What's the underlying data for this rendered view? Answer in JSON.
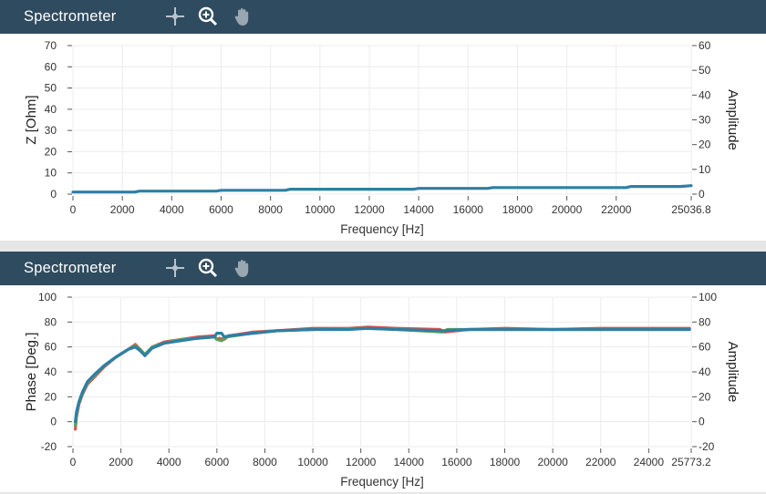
{
  "panels": [
    {
      "title": "Spectrometer",
      "tools": {
        "crosshair": "crosshair-icon",
        "zoom": "zoom-in-icon",
        "pan": "hand-pan-icon"
      },
      "chart_data": {
        "type": "line",
        "xlabel": "Frequency [Hz]",
        "ylabel": "Z [Ohm]",
        "y2label": "Amplitude",
        "xlim": [
          0,
          25036.8
        ],
        "ylim": [
          0,
          70
        ],
        "y2lim": [
          0,
          60
        ],
        "xticks": [
          "0",
          "2000",
          "4000",
          "6000",
          "8000",
          "10000",
          "12000",
          "14000",
          "16000",
          "18000",
          "20000",
          "22000",
          "25036.8"
        ],
        "yticks": [
          "0",
          "10",
          "20",
          "30",
          "40",
          "50",
          "60",
          "70"
        ],
        "y2ticks": [
          "0",
          "10",
          "20",
          "30",
          "40",
          "50",
          "60"
        ],
        "grid": true,
        "series": [
          {
            "color": "#2e7fa6",
            "x": [
              0,
              2500,
              2700,
              5800,
              6000,
              8600,
              8800,
              13800,
              14000,
              16800,
              17000,
              22400,
              22600,
              24600,
              25036.8
            ],
            "y": [
              1.0,
              1.0,
              1.4,
              1.4,
              1.8,
              1.8,
              2.3,
              2.3,
              2.7,
              2.7,
              3.1,
              3.1,
              3.6,
              3.6,
              4.0
            ]
          }
        ]
      }
    },
    {
      "title": "Spectrometer",
      "tools": {
        "crosshair": "crosshair-icon",
        "zoom": "zoom-in-icon",
        "pan": "hand-pan-icon"
      },
      "chart_data": {
        "type": "line",
        "xlabel": "Frequency [Hz]",
        "ylabel": "Phase [Deg.]",
        "y2label": "Amplitude",
        "xlim": [
          0,
          25773.2
        ],
        "ylim": [
          -20,
          100
        ],
        "y2lim": [
          -20,
          100
        ],
        "xticks": [
          "0",
          "2000",
          "4000",
          "6000",
          "8000",
          "10000",
          "12000",
          "14000",
          "16000",
          "18000",
          "20000",
          "22000",
          "24000",
          "25773.2"
        ],
        "yticks": [
          "-20",
          "0",
          "20",
          "40",
          "60",
          "80",
          "100"
        ],
        "y2ticks": [
          "-20",
          "0",
          "20",
          "40",
          "60",
          "80",
          "100"
        ],
        "grid": true,
        "series": [
          {
            "color": "#d9534f",
            "x": [
              100,
              150,
              250,
              400,
              600,
              900,
              1300,
              1800,
              2300,
              2600,
              2800,
              3000,
              3300,
              3800,
              4500,
              5200,
              5900,
              6000,
              6100,
              6300,
              6500,
              7500,
              8500,
              10000,
              11500,
              12300,
              13500,
              15300,
              15500,
              16500,
              18000,
              20000,
              22000,
              24000,
              25700
            ],
            "y": [
              -6,
              4,
              14,
              22,
              30,
              36,
              44,
              52,
              58,
              62,
              58,
              53,
              60,
              64,
              66,
              68,
              69,
              66,
              67,
              66,
              69,
              72,
              73,
              75,
              75,
              76,
              75,
              74,
              72,
              74,
              75,
              74,
              75,
              75,
              75
            ]
          },
          {
            "color": "#5aa05a",
            "x": [
              100,
              150,
              250,
              400,
              600,
              900,
              1300,
              1800,
              2300,
              2600,
              2800,
              3000,
              3300,
              3800,
              4500,
              5200,
              5900,
              6000,
              6200,
              6400,
              7500,
              8500,
              10000,
              12000,
              13500,
              15400,
              15600,
              16500,
              18000,
              20000,
              22000,
              24000,
              25700
            ],
            "y": [
              -3,
              6,
              15,
              23,
              31,
              37,
              45,
              52,
              58,
              61,
              58,
              54,
              60,
              63,
              66,
              67,
              68,
              66,
              65,
              68,
              71,
              73,
              74,
              75,
              74,
              72,
              74,
              74,
              74,
              74,
              74,
              74,
              74
            ]
          },
          {
            "color": "#2e7fa6",
            "x": [
              100,
              150,
              250,
              400,
              600,
              900,
              1300,
              1800,
              2300,
              2600,
              2800,
              3000,
              3300,
              3800,
              4500,
              5200,
              5900,
              6000,
              6100,
              6200,
              6300,
              6500,
              7500,
              8500,
              10000,
              11500,
              12300,
              13500,
              15500,
              16500,
              18000,
              20000,
              22000,
              24000,
              25700
            ],
            "y": [
              0,
              8,
              16,
              24,
              32,
              38,
              45,
              52,
              58,
              60,
              57,
              53,
              59,
              63,
              65,
              67,
              68,
              71,
              71,
              71,
              68,
              69,
              71,
              73,
              74,
              74,
              75,
              74,
              73,
              74,
              74,
              74,
              74,
              74,
              74
            ]
          }
        ]
      }
    }
  ]
}
